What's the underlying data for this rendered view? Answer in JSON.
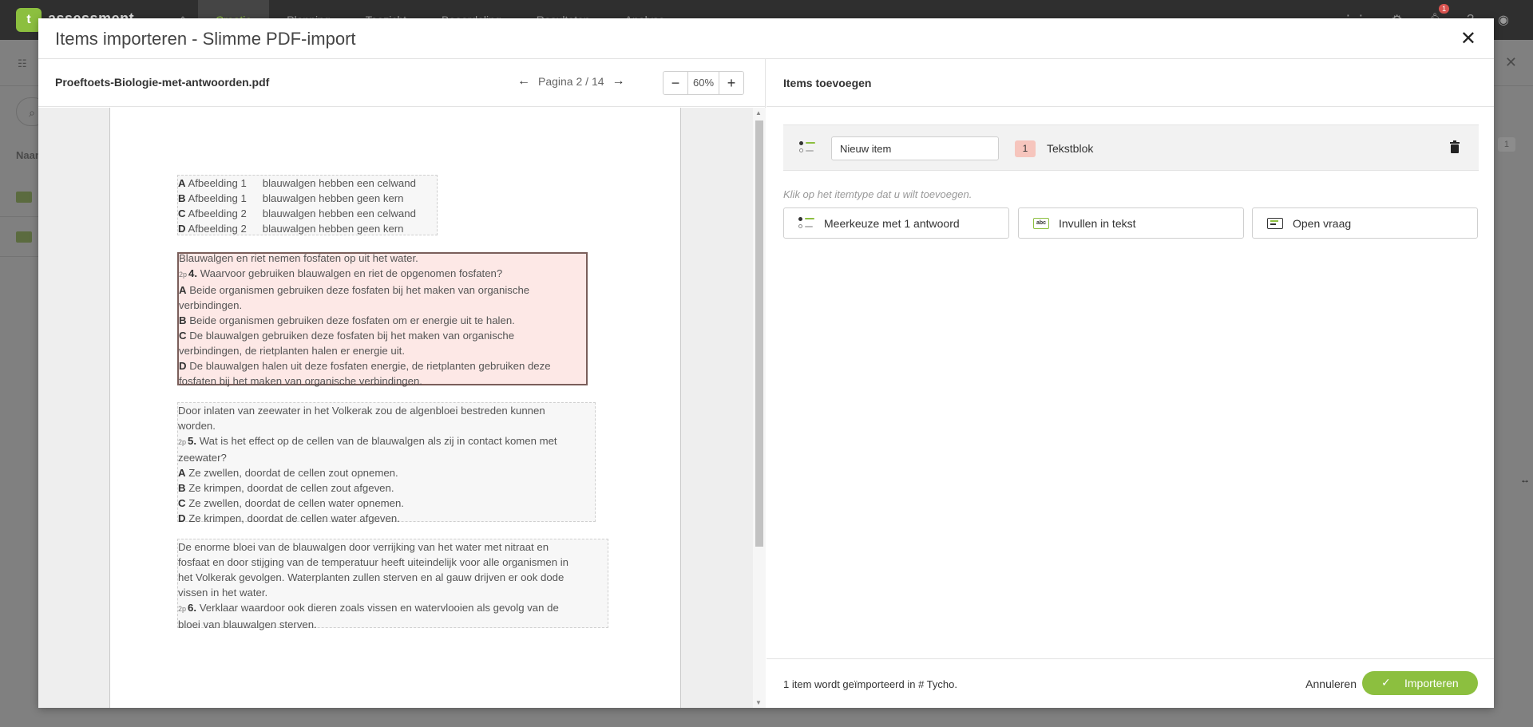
{
  "background": {
    "brand": "assessment",
    "nav_tabs": [
      "Creatie",
      "Planning",
      "Toezicht",
      "Beoordeling",
      "Resultaten",
      "Analyse"
    ],
    "notification_count": "1",
    "column_header": "Naam",
    "count_badge": "1"
  },
  "modal": {
    "title": "Items importeren - Slimme PDF-import",
    "pdf": {
      "file_name": "Proeftoets-Biologie-met-antwoorden.pdf",
      "page_label": "Pagina 2 / 14",
      "zoom": "60%",
      "blocks": {
        "b1": [
          {
            "letter": "A",
            "col1": "Afbeelding 1",
            "col2": "blauwalgen hebben een celwand"
          },
          {
            "letter": "B",
            "col1": "Afbeelding 1",
            "col2": "blauwalgen hebben geen kern"
          },
          {
            "letter": "C",
            "col1": "Afbeelding 2",
            "col2": "blauwalgen hebben een celwand"
          },
          {
            "letter": "D",
            "col1": "Afbeelding 2",
            "col2": "blauwalgen hebben geen kern"
          }
        ],
        "b2": {
          "intro": "Blauwalgen en riet nemen fosfaten op uit het water.",
          "points": "2p",
          "qnum": "4.",
          "question": "Waarvoor gebruiken blauwalgen en riet de opgenomen fosfaten?",
          "options": [
            {
              "letter": "A",
              "line1": "Beide organismen gebruiken deze fosfaten bij het maken van organische",
              "line2": "verbindingen."
            },
            {
              "letter": "B",
              "line1": "Beide organismen gebruiken deze fosfaten om er energie uit te halen.",
              "line2": ""
            },
            {
              "letter": "C",
              "line1": "De blauwalgen gebruiken deze fosfaten bij het maken van organische",
              "line2": "verbindingen, de rietplanten halen er energie uit."
            },
            {
              "letter": "D",
              "line1": "De blauwalgen halen uit deze fosfaten energie, de rietplanten gebruiken deze",
              "line2": "fosfaten bij het maken van organische verbindingen."
            }
          ]
        },
        "b3": {
          "intro1": "Door inlaten van zeewater in het Volkerak zou de algenbloei bestreden kunnen",
          "intro2": "worden.",
          "points": "2p",
          "qnum": "5.",
          "question1": "Wat is het effect op de cellen van de blauwalgen als zij in contact komen met",
          "question2": "zeewater?",
          "options": [
            {
              "letter": "A",
              "text": "Ze zwellen, doordat de cellen zout opnemen."
            },
            {
              "letter": "B",
              "text": "Ze krimpen, doordat de cellen zout afgeven."
            },
            {
              "letter": "C",
              "text": "Ze zwellen, doordat de cellen water opnemen."
            },
            {
              "letter": "D",
              "text": "Ze krimpen, doordat de cellen water afgeven."
            }
          ]
        },
        "b4": {
          "lines": [
            "De enorme bloei van de blauwalgen door verrijking van het water met nitraat en",
            "fosfaat en door stijging van de temperatuur heeft uiteindelijk voor alle organismen in",
            "het Volkerak gevolgen. Waterplanten zullen sterven en al gauw drijven er ook dode",
            "vissen in het water."
          ],
          "points": "2p",
          "qnum": "6.",
          "question1": "Verklaar waardoor ook dieren zoals vissen en watervlooien als gevolg van de",
          "question2": "bloei van blauwalgen sterven."
        }
      }
    },
    "right": {
      "title": "Items toevoegen",
      "item": {
        "name_value": "Nieuw item",
        "badge": "1",
        "type_label": "Tekstblok"
      },
      "hint": "Klik op het itemtype dat u wilt toevoegen.",
      "types": [
        "Meerkeuze met 1 antwoord",
        "Invullen in tekst",
        "Open vraag"
      ],
      "footer_text": "1 item wordt geïmporteerd in # Tycho.",
      "cancel_label": "Annuleren",
      "import_label": "Importeren"
    }
  },
  "colors": {
    "accent": "#8cbf3f",
    "selected_block": "#fde8e6",
    "badge": "#f6c5bd"
  }
}
